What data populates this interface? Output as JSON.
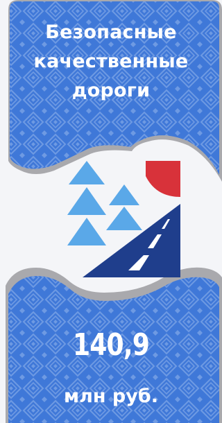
{
  "header": {
    "title_line1": "Безопасные",
    "title_line2": "качественные",
    "title_line3": "дороги"
  },
  "figure": {
    "amount": "140,9",
    "unit": "млн руб."
  },
  "logo": {
    "icon": "road-and-fir-trees-logo-icon"
  },
  "colors": {
    "panel_blue": "#3f78d8",
    "pattern_blue": "#6e9ae3",
    "shadow_gray": "#a9a9ad",
    "page_bg": "#f4f5f8",
    "tree_blue": "#5aa8e8",
    "road_navy": "#1f3e8c",
    "sun_red": "#d8323a"
  }
}
